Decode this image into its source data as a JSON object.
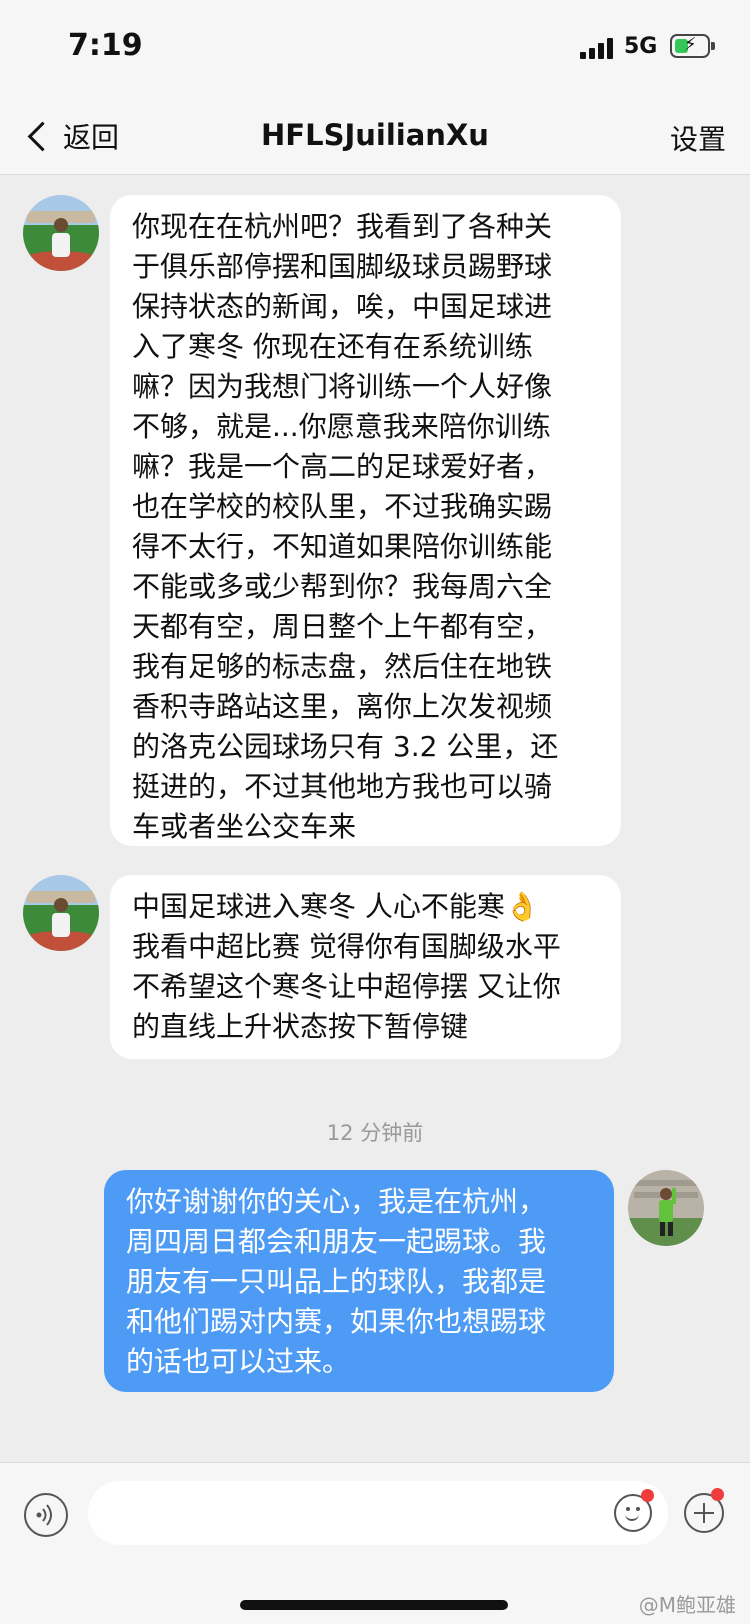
{
  "status_bar": {
    "time": "7:19",
    "network": "5G"
  },
  "nav": {
    "back_label": "返回",
    "title": "HFLSJuilianXu",
    "settings_label": "设置"
  },
  "messages": [
    {
      "direction": "incoming",
      "lines": [
        "你现在在杭州吧？我看到了各种关",
        "于俱乐部停摆和国脚级球员踢野球",
        "保持状态的新闻，唉，中国足球进",
        "入了寒冬 你现在还有在系统训练",
        "嘛？因为我想门将训练一个人好像",
        "不够，就是...你愿意我来陪你训练",
        "嘛？我是一个高二的足球爱好者，",
        "也在学校的校队里，不过我确实踢",
        "得不太行，不知道如果陪你训练能",
        "不能或多或少帮到你？我每周六全",
        "天都有空，周日整个上午都有空，",
        "我有足够的标志盘，然后住在地铁",
        "香积寺路站这里，离你上次发视频",
        "的洛克公园球场只有 3.2 公里，还",
        "挺进的，不过其他地方我也可以骑",
        "车或者坐公交车来"
      ]
    },
    {
      "direction": "incoming",
      "lines": [
        "中国足球进入寒冬 人心不能寒👌",
        "我看中超比赛 觉得你有国脚级水平",
        "不希望这个寒冬让中超停摆 又让你",
        "的直线上升状态按下暂停键"
      ]
    },
    {
      "direction": "outgoing",
      "lines": [
        "你好谢谢你的关心，我是在杭州，",
        "周四周日都会和朋友一起踢球。我",
        "朋友有一只叫品上的球队，我都是",
        "和他们踢对内赛，如果你也想踢球",
        "的话也可以过来。"
      ]
    }
  ],
  "timestamp": "12 分钟前",
  "input": {
    "placeholder": ""
  },
  "watermark": "@M鲍亚雄"
}
